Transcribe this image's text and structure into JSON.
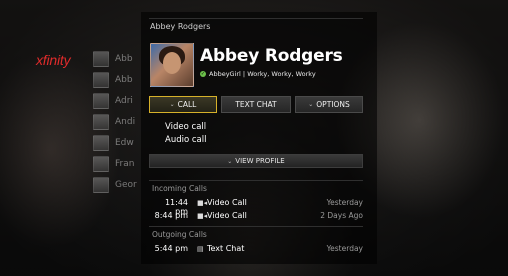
{
  "brand": {
    "logo_text": "xfinity",
    "color": "#e02b2b"
  },
  "contacts": [
    {
      "name": "Abb",
      "sub": "●"
    },
    {
      "name": "Abb",
      "sub": "●"
    },
    {
      "name": "Adri",
      "sub": "●"
    },
    {
      "name": "Andi",
      "sub": "●"
    },
    {
      "name": "Edw",
      "sub": "●"
    },
    {
      "name": "Fran",
      "sub": "●"
    },
    {
      "name": "Geor",
      "sub": "●"
    }
  ],
  "profile": {
    "header_name": "Abbey Rodgers",
    "name": "Abbey Rodgers",
    "status_check": "✓",
    "status_text": "AbbeyGirl | Worky, Worky, Worky",
    "status_color": "#6cc04a"
  },
  "actions": {
    "call_label": "CALL",
    "text_chat_label": "TEXT CHAT",
    "options_label": "OPTIONS",
    "chevron": "⌄"
  },
  "call_menu": {
    "items": [
      "Video call",
      "Audio call"
    ]
  },
  "view_profile_label": "VIEW PROFILE",
  "incoming": {
    "label": "Incoming Calls",
    "rows": [
      {
        "time": "11:44 pm",
        "icon": "video-camera-icon",
        "type": "Video Call",
        "when": "Yesterday"
      },
      {
        "time": "8:44 pm",
        "icon": "video-camera-icon",
        "type": "Video Call",
        "when": "2 Days Ago"
      }
    ]
  },
  "outgoing": {
    "label": "Outgoing Calls",
    "rows": [
      {
        "time": "5:44 pm",
        "icon": "chat-bubble-icon",
        "type": "Text Chat",
        "when": "Yesterday"
      }
    ]
  },
  "colors": {
    "focus": "#d6b12a"
  }
}
